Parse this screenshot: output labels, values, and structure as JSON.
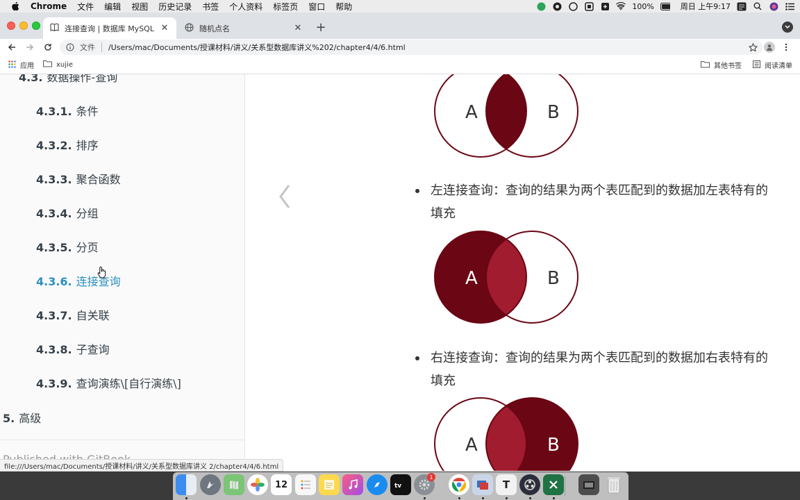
{
  "menubar": {
    "app_name": "Chrome",
    "items": [
      "文件",
      "编辑",
      "视图",
      "历史记录",
      "书签",
      "个人资料",
      "标签页",
      "窗口",
      "帮助"
    ],
    "battery": "100%",
    "clock": "周日 上午9:17"
  },
  "tabs": [
    {
      "title": "连接查询 | 数据库 MySQL",
      "icon": "book-icon"
    },
    {
      "title": "随机点名",
      "icon": "globe-icon"
    }
  ],
  "omnibox": {
    "scheme_label": "文件",
    "url": "/Users/mac/Documents/授课材料/讲义/关系型数据库讲义%202/chapter4/4/6.html"
  },
  "bookmarks": {
    "apps": "应用",
    "folder": "xujie",
    "other": "其他书签",
    "reading_list": "阅读清单"
  },
  "sidebar": {
    "top_item": {
      "num": "4.3.",
      "label": "数据操作-查询"
    },
    "items": [
      {
        "num": "4.3.1.",
        "label": "条件"
      },
      {
        "num": "4.3.2.",
        "label": "排序"
      },
      {
        "num": "4.3.3.",
        "label": "聚合函数"
      },
      {
        "num": "4.3.4.",
        "label": "分组"
      },
      {
        "num": "4.3.5.",
        "label": "分页"
      },
      {
        "num": "4.3.6.",
        "label": "连接查询"
      },
      {
        "num": "4.3.7.",
        "label": "自关联"
      },
      {
        "num": "4.3.8.",
        "label": "子查询"
      },
      {
        "num": "4.3.9.",
        "label": "查询演练\\[自行演练\\]"
      }
    ],
    "active_index": 5,
    "level1_item": {
      "num": "5.",
      "label": "高级"
    },
    "footer": "Published with GitBook"
  },
  "content": {
    "left_join": {
      "line1": "左连接查询：查询的结果为两个表匹配到的数据加左表特有的",
      "line2": "填充"
    },
    "right_join": {
      "line1": "右连接查询：查询的结果为两个表匹配到的数据加右表特有的",
      "line2": "填充"
    },
    "venn_label_a": "A",
    "venn_label_b": "B"
  },
  "status_url": "file:///Users/mac/Documents/授课材料/讲义/关系型数据库讲义 2/chapter4/4/6.html",
  "dock": {
    "calendar_day": "12",
    "settings_badge": "1",
    "typora_letter": "T"
  },
  "colors": {
    "venn_dark": "#6b0614",
    "venn_light": "#a01c2e",
    "active_link": "#2c8fc0"
  }
}
